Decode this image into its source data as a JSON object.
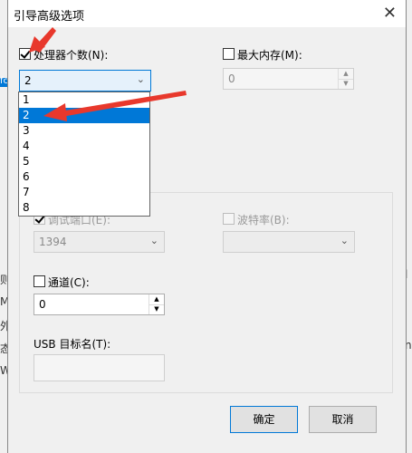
{
  "dialog": {
    "title": "引导高级选项",
    "close_glyph": "✕"
  },
  "processors": {
    "label": "处理器个数(N):",
    "checked": true,
    "selected": "2",
    "options": [
      "1",
      "2",
      "3",
      "4",
      "5",
      "6",
      "7",
      "8"
    ]
  },
  "max_memory": {
    "label": "最大内存(M):",
    "checked": false,
    "value": "0"
  },
  "debug": {
    "port_label": "调试端口(E):",
    "port_value": "1394",
    "baud_label": "波特率(B):",
    "baud_value": "",
    "channel_label": "通道(C):",
    "channel_value": "0",
    "usb_label": "USB 目标名(T):",
    "usb_value": ""
  },
  "buttons": {
    "ok": "确定",
    "cancel": "取消"
  },
  "background": {
    "left_fragments": [
      "fc",
      "则",
      "M",
      "外",
      "态",
      "W"
    ],
    "right_fragments": [
      "l",
      "n"
    ]
  },
  "colors": {
    "accent": "#0078d7",
    "annotation_arrow": "#e8382c"
  },
  "icons": [
    "close-icon",
    "checkbox-icon",
    "chevron-down-icon",
    "spin-up-icon",
    "spin-down-icon",
    "red-arrow-annotation"
  ]
}
